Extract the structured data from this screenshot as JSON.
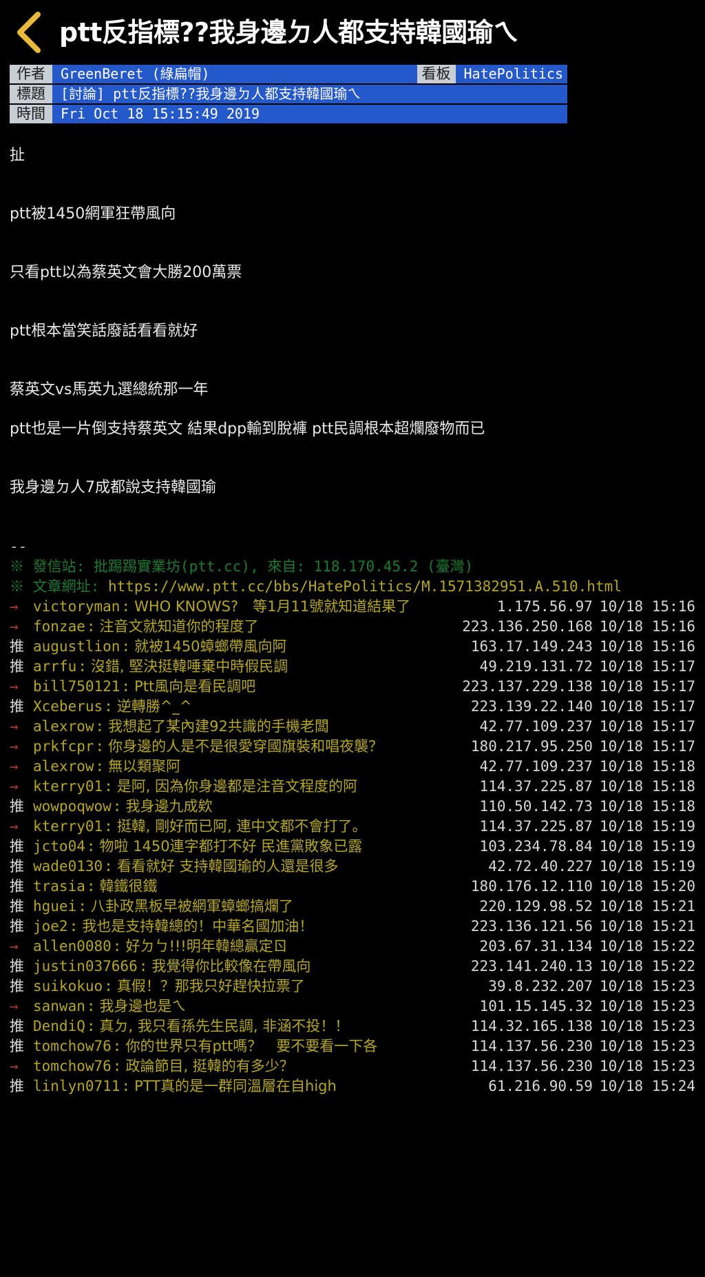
{
  "navbar": {
    "back_icon": "chevron-left-icon",
    "title": "ptt反指標??我身邊ㄉ人都支持韓國瑜ㄟ"
  },
  "article_meta": {
    "author_label": "作者",
    "author_value": "GreenBeret (綠扁帽)",
    "board_label": "看板",
    "board_value": "HatePolitics",
    "title_label": "標題",
    "title_value": "[討論] ptt反指標??我身邊ㄉ人都支持韓國瑜ㄟ",
    "time_label": "時間",
    "time_value": "Fri Oct 18 15:15:49 2019"
  },
  "post_body": {
    "paragraphs": [
      "扯",
      "ptt被1450網軍狂帶風向",
      "只看ptt以為蔡英文會大勝200萬票",
      "ptt根本當笑話廢話看看就好",
      "蔡英文vs馬英九選總統那一年"
    ],
    "paragraph_long": "ptt也是一片倒支持蔡英文  結果dpp輸到脫褲  ptt民調根本超爛廢物而已",
    "paragraph_last": "我身邊ㄉ人7成都說支持韓國瑜",
    "signature_dashes": "--",
    "signature_from": "※ 發信站: 批踢踢實業坊(ptt.cc), 來自: 118.170.45.2 (臺灣)",
    "signature_url_label": "※ 文章網址: ",
    "signature_url": "https://www.ptt.cc/bbs/HatePolitics/M.1571382951.A.510.html"
  },
  "comments": [
    {
      "tag": "→",
      "tag_type": "arrow",
      "user": "victoryman",
      "text": "WHO KNOWS?　等1月11號就知道結果了",
      "ip": "1.175.56.97",
      "time": "10/18 15:16"
    },
    {
      "tag": "→",
      "tag_type": "arrow",
      "user": "fonzae",
      "text": "注音文就知道你的程度了",
      "ip": "223.136.250.168",
      "time": "10/18 15:16"
    },
    {
      "tag": "推",
      "tag_type": "push",
      "user": "augustlion",
      "text": "就被1450蟑螂帶風向阿",
      "ip": "163.17.149.243",
      "time": "10/18 15:16"
    },
    {
      "tag": "推",
      "tag_type": "push",
      "user": "arrfu",
      "text": "沒錯, 堅決挺韓唾棄中時假民調",
      "ip": "49.219.131.72",
      "time": "10/18 15:17"
    },
    {
      "tag": "→",
      "tag_type": "arrow",
      "user": "bill750121",
      "text": "Ptt風向是看民調吧",
      "ip": "223.137.229.138",
      "time": "10/18 15:17"
    },
    {
      "tag": "推",
      "tag_type": "push",
      "user": "Xceberus",
      "text": "逆轉勝^_^",
      "ip": "223.139.22.140",
      "time": "10/18 15:17"
    },
    {
      "tag": "→",
      "tag_type": "arrow",
      "user": "alexrow",
      "text": "我想起了某內建92共識的手機老闆",
      "ip": "42.77.109.237",
      "time": "10/18 15:17"
    },
    {
      "tag": "→",
      "tag_type": "arrow",
      "user": "prkfcpr",
      "text": "你身邊的人是不是很愛穿國旗裝和唱夜襲？",
      "ip": "180.217.95.250",
      "time": "10/18 15:17"
    },
    {
      "tag": "→",
      "tag_type": "arrow",
      "user": "alexrow",
      "text": "無以類聚阿",
      "ip": "42.77.109.237",
      "time": "10/18 15:18"
    },
    {
      "tag": "→",
      "tag_type": "arrow",
      "user": "kterry01",
      "text": "是阿, 因為你身邊都是注音文程度的阿",
      "ip": "114.37.225.87",
      "time": "10/18 15:18"
    },
    {
      "tag": "推",
      "tag_type": "push",
      "user": "wowpoqwow",
      "text": "我身邊九成欸",
      "ip": "110.50.142.73",
      "time": "10/18 15:18"
    },
    {
      "tag": "→",
      "tag_type": "arrow",
      "user": "kterry01",
      "text": "挺韓, 剛好而已阿, 連中文都不會打了。",
      "ip": "114.37.225.87",
      "time": "10/18 15:19"
    },
    {
      "tag": "推",
      "tag_type": "push",
      "user": "jcto04",
      "text": "物啦 1450連字都打不好 民進黨敗象已露",
      "ip": "103.234.78.84",
      "time": "10/18 15:19"
    },
    {
      "tag": "推",
      "tag_type": "push",
      "user": "wade0130",
      "text": "看看就好 支持韓國瑜的人還是很多",
      "ip": "42.72.40.227",
      "time": "10/18 15:19"
    },
    {
      "tag": "推",
      "tag_type": "push",
      "user": "trasia",
      "text": "韓鐵很鐵",
      "ip": "180.176.12.110",
      "time": "10/18 15:20"
    },
    {
      "tag": "推",
      "tag_type": "push",
      "user": "hguei",
      "text": "八卦政黑板早被網軍蟑螂搞爛了",
      "ip": "220.129.98.52",
      "time": "10/18 15:21"
    },
    {
      "tag": "推",
      "tag_type": "push",
      "user": "joe2",
      "text": "我也是支持韓總的！中華名國加油！",
      "ip": "223.136.121.56",
      "time": "10/18 15:21"
    },
    {
      "tag": "→",
      "tag_type": "arrow",
      "user": "allen0080",
      "text": "好ㄉㄅ!!!明年韓總贏定ㄖ",
      "ip": "203.67.31.134",
      "time": "10/18 15:22"
    },
    {
      "tag": "推",
      "tag_type": "push",
      "user": "justin037666",
      "text": "我覺得你比較像在帶風向",
      "ip": "223.141.240.13",
      "time": "10/18 15:22"
    },
    {
      "tag": "推",
      "tag_type": "push",
      "user": "suikokuo",
      "text": "真假！？那我只好趕快拉票了",
      "ip": "39.8.232.207",
      "time": "10/18 15:23"
    },
    {
      "tag": "→",
      "tag_type": "arrow",
      "user": "sanwan",
      "text": "我身邊也是ㄟ",
      "ip": "101.15.145.32",
      "time": "10/18 15:23"
    },
    {
      "tag": "推",
      "tag_type": "push",
      "user": "DendiQ",
      "text": "真ㄉ, 我只看孫先生民調, 非涵不投！！",
      "ip": "114.32.165.138",
      "time": "10/18 15:23"
    },
    {
      "tag": "推",
      "tag_type": "push",
      "user": "tomchow76",
      "text": "你的世界只有ptt嗎？　要不要看一下各",
      "ip": "114.137.56.230",
      "time": "10/18 15:23"
    },
    {
      "tag": "→",
      "tag_type": "arrow",
      "user": "tomchow76",
      "text": "政論節目, 挺韓的有多少？",
      "ip": "114.137.56.230",
      "time": "10/18 15:23"
    },
    {
      "tag": "推",
      "tag_type": "push",
      "user": "linlyn0711",
      "text": "PTT真的是一群同溫層在自high",
      "ip": "61.216.90.59",
      "time": "10/18 15:24"
    }
  ],
  "colors": {
    "background": "#000000",
    "meta_blue": "#2558c8",
    "meta_label_grey": "#c9cdd4",
    "comment_yellow": "#b5a625",
    "arrow_red": "#b03a3a",
    "signature_green": "#1f7a32",
    "back_arrow_gold": "#e8b93a"
  }
}
